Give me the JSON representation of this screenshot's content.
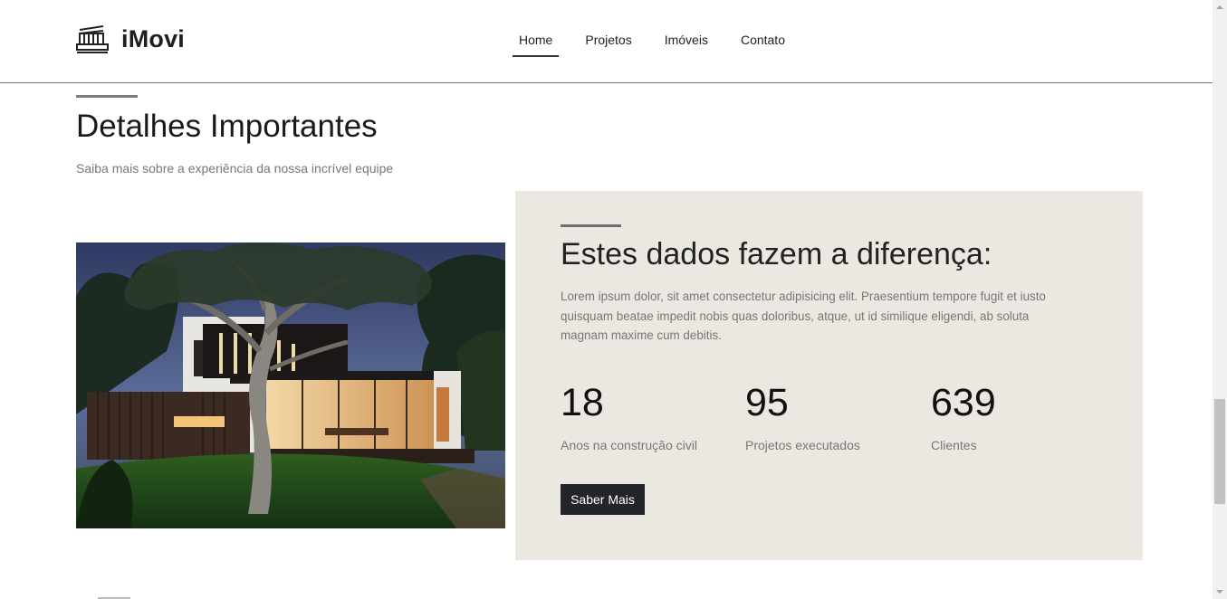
{
  "header": {
    "brand": "iMovi",
    "nav": [
      {
        "label": "Home",
        "active": true
      },
      {
        "label": "Projetos",
        "active": false
      },
      {
        "label": "Imóveis",
        "active": false
      },
      {
        "label": "Contato",
        "active": false
      }
    ]
  },
  "details": {
    "title": "Detalhes Importantes",
    "subtitle": "Saiba mais sobre a experiência da nossa incrível equipe"
  },
  "image": {
    "icon": "modern-house-photo"
  },
  "stats_panel": {
    "title": "Estes dados fazem a diferença:",
    "text": "Lorem ipsum dolor, sit amet consectetur adipisicing elit. Praesentium tempore fugit et iusto quisquam beatae impedit nobis quas doloribus, atque, ut id similique eligendi, ab soluta magnam maxime cum debitis.",
    "stats": [
      {
        "value": "18",
        "label": "Anos na construção civil"
      },
      {
        "value": "95",
        "label": "Projetos executados"
      },
      {
        "value": "639",
        "label": "Clientes"
      }
    ],
    "button_label": "Saber Mais"
  },
  "colors": {
    "panel_bg": "#ebe8e1",
    "button_bg": "#23252a",
    "accent_bar": "#7b7b7b"
  }
}
